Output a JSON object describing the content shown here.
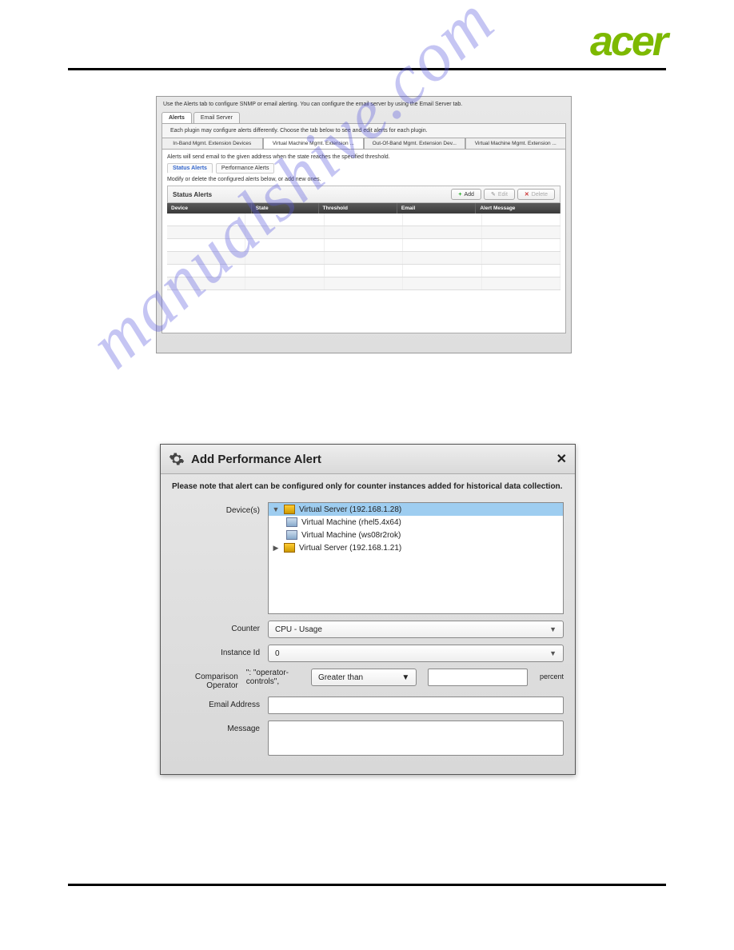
{
  "brand": "acer",
  "watermark": "manualshive.com",
  "panel1": {
    "intro": "Use the Alerts tab to configure SNMP or email alerting.  You can configure the email server by using the Email Server tab.",
    "tabs_main": [
      "Alerts",
      "Email Server"
    ],
    "sub_desc": "Each plugin may configure alerts differently.  Choose the tab below to see and edit alerts for each plugin.",
    "tabs_plugin": [
      "In-Band Mgmt. Extension Devices",
      "Virtual Machine Mgmt. Extension ...",
      "Out-Of-Band Mgmt. Extension Dev...",
      "Virtual Machine Mgmt. Extension ..."
    ],
    "alerts_note": "Alerts will send email to the given address when the state reaches the specified threshold.",
    "tabs_alert": [
      "Status Alerts",
      "Performance Alerts"
    ],
    "modify_note": "Modify or delete the configured alerts below, or add new ones.",
    "section_title": "Status Alerts",
    "buttons": {
      "add": "Add",
      "edit": "Edit",
      "delete": "Delete"
    },
    "columns": [
      "Device",
      "State",
      "Threshold",
      "Email",
      "Alert Message"
    ]
  },
  "panel2": {
    "title": "Add Performance Alert",
    "note": "Please note that alert can be configured only for counter instances added for historical data collection.",
    "labels": {
      "devices": "Device(s)",
      "counter": "Counter",
      "instance": "Instance Id",
      "operator": "Comparison Operator",
      "email": "Email Address",
      "message": "Message"
    },
    "tree": {
      "server1": "Virtual Server (192.168.1.28)",
      "vm1": "Virtual Machine (rhel5.4x64)",
      "vm2": "Virtual Machine (ws08r2rok)",
      "server2": "Virtual Server (192.168.1.21)"
    },
    "values": {
      "counter": "CPU - Usage",
      "instance": "0",
      "operator": "Greater than",
      "threshold": "",
      "unit": "percent",
      "email": "",
      "message": ""
    }
  }
}
